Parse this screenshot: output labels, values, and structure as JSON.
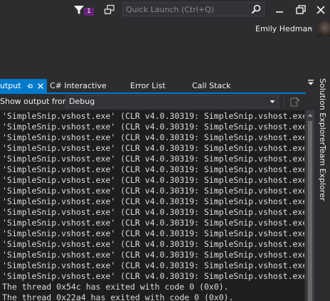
{
  "titlebar": {
    "notification_count": "1",
    "quick_launch_placeholder": "Quick Launch (Ctrl+Q)",
    "user_name": "Emily Hedman",
    "icons": [
      "filter-icon",
      "feedback-icon",
      "search-icon",
      "minimize-icon",
      "restore-icon",
      "close-icon",
      "chevron-down-icon",
      "avatar"
    ]
  },
  "tabs": [
    {
      "label": "utput",
      "active": true
    },
    {
      "label": "C# Interactive",
      "active": false
    },
    {
      "label": "Error List",
      "active": false
    },
    {
      "label": "Call Stack",
      "active": false
    }
  ],
  "side_tabs": [
    "Solution Explorer",
    "Team Explorer"
  ],
  "toolbar": {
    "show_output_label": "Show output from:",
    "source_value": "Debug"
  },
  "output_lines": [
    "'SimpleSnip.vshost.exe' (CLR v4.0.30319: SimpleSnip.vshost.exe",
    "'SimpleSnip.vshost.exe' (CLR v4.0.30319: SimpleSnip.vshost.exe",
    "'SimpleSnip.vshost.exe' (CLR v4.0.30319: SimpleSnip.vshost.exe",
    "'SimpleSnip.vshost.exe' (CLR v4.0.30319: SimpleSnip.vshost.exe",
    "'SimpleSnip.vshost.exe' (CLR v4.0.30319: SimpleSnip.vshost.exe",
    "'SimpleSnip.vshost.exe' (CLR v4.0.30319: SimpleSnip.vshost.exe",
    "'SimpleSnip.vshost.exe' (CLR v4.0.30319: SimpleSnip.vshost.exe",
    "'SimpleSnip.vshost.exe' (CLR v4.0.30319: SimpleSnip.vshost.exe",
    "'SimpleSnip.vshost.exe' (CLR v4.0.30319: SimpleSnip.vshost.exe",
    "'SimpleSnip.vshost.exe' (CLR v4.0.30319: SimpleSnip.vshost.exe",
    "'SimpleSnip.vshost.exe' (CLR v4.0.30319: SimpleSnip.vshost.exe",
    "'SimpleSnip.vshost.exe' (CLR v4.0.30319: SimpleSnip.vshost.exe",
    "'SimpleSnip.vshost.exe' (CLR v4.0.30319: SimpleSnip.vshost.exe",
    "'SimpleSnip.vshost.exe' (CLR v4.0.30319: SimpleSnip.vshost.exe",
    "'SimpleSnip.vshost.exe' (CLR v4.0.30319: SimpleSnip.vshost.exe",
    "'SimpleSnip.vshost.exe' (CLR v4.0.30319: SimpleSnip.vshost.exe",
    "The thread 0x54c has exited with code 0 (0x0).",
    "The thread 0x22a4 has exited with code 0 (0x0)."
  ],
  "colors": {
    "accent": "#007acc",
    "badge": "#68217a",
    "chrome_bg": "#2d2d30",
    "output_bg": "#1e1e1e"
  }
}
